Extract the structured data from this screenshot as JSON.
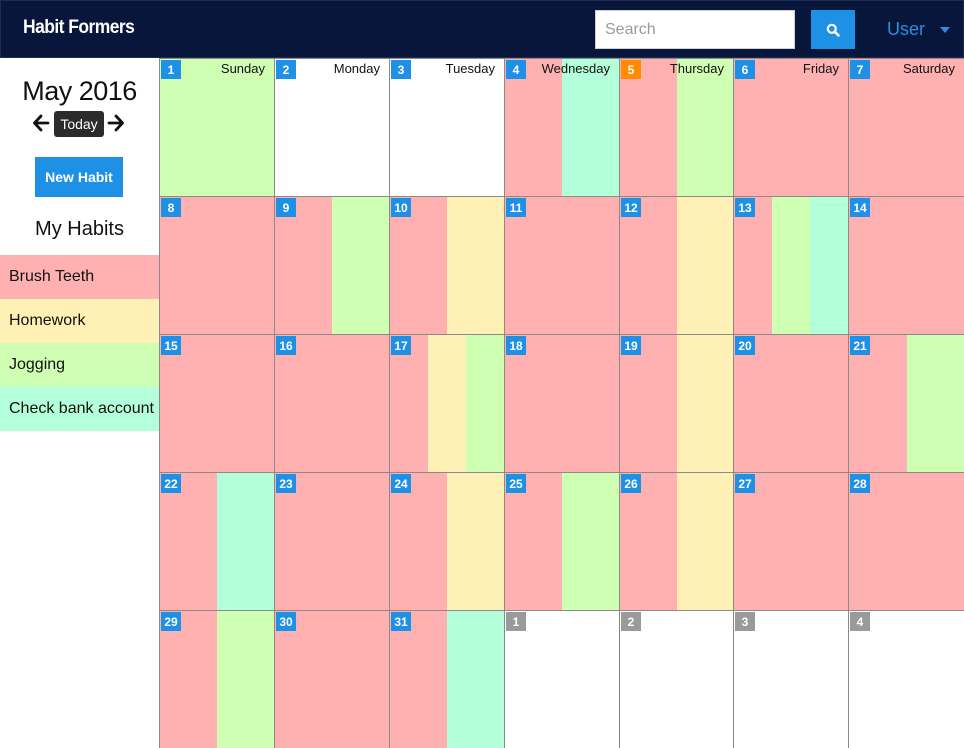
{
  "app": {
    "brand": "Habit Formers"
  },
  "search": {
    "placeholder": "Search"
  },
  "user_menu": {
    "label": "User"
  },
  "sidebar": {
    "month_title": "May 2016",
    "today_label": "Today",
    "new_habit_label": "New Habit",
    "habits_heading": "My Habits"
  },
  "habits": [
    {
      "name": "Brush Teeth",
      "color": "#ffb1b1"
    },
    {
      "name": "Homework",
      "color": "#fff0b5"
    },
    {
      "name": "Jogging",
      "color": "#cfffb3"
    },
    {
      "name": "Check bank account",
      "color": "#b3ffd9"
    }
  ],
  "colors": {
    "navbar": "#07163a",
    "accent_blue": "#1e90e6",
    "badge_current_month": "#1e90e6",
    "badge_today": "#ff8c00",
    "badge_other_month": "#9a9a9a"
  },
  "weekdays": [
    "Sunday",
    "Monday",
    "Tuesday",
    "Wednesday",
    "Thursday",
    "Friday",
    "Saturday"
  ],
  "calendar": {
    "weeks": [
      [
        {
          "day": "1",
          "status": "current",
          "habits": [
            2
          ]
        },
        {
          "day": "2",
          "status": "current",
          "habits": []
        },
        {
          "day": "3",
          "status": "current",
          "habits": []
        },
        {
          "day": "4",
          "status": "current",
          "habits": [
            0,
            3
          ]
        },
        {
          "day": "5",
          "status": "today",
          "habits": [
            0,
            2
          ]
        },
        {
          "day": "6",
          "status": "current",
          "habits": [
            0
          ]
        },
        {
          "day": "7",
          "status": "current",
          "habits": [
            0
          ]
        }
      ],
      [
        {
          "day": "8",
          "status": "current",
          "habits": [
            0
          ]
        },
        {
          "day": "9",
          "status": "current",
          "habits": [
            0,
            2
          ]
        },
        {
          "day": "10",
          "status": "current",
          "habits": [
            0,
            1
          ]
        },
        {
          "day": "11",
          "status": "current",
          "habits": [
            0
          ]
        },
        {
          "day": "12",
          "status": "current",
          "habits": [
            0,
            1
          ]
        },
        {
          "day": "13",
          "status": "current",
          "habits": [
            0,
            2,
            3
          ]
        },
        {
          "day": "14",
          "status": "current",
          "habits": [
            0
          ]
        }
      ],
      [
        {
          "day": "15",
          "status": "current",
          "habits": [
            0
          ]
        },
        {
          "day": "16",
          "status": "current",
          "habits": [
            0
          ]
        },
        {
          "day": "17",
          "status": "current",
          "habits": [
            0,
            1,
            2
          ]
        },
        {
          "day": "18",
          "status": "current",
          "habits": [
            0
          ]
        },
        {
          "day": "19",
          "status": "current",
          "habits": [
            0,
            1
          ]
        },
        {
          "day": "20",
          "status": "current",
          "habits": [
            0
          ]
        },
        {
          "day": "21",
          "status": "current",
          "habits": [
            0,
            2
          ]
        }
      ],
      [
        {
          "day": "22",
          "status": "current",
          "habits": [
            0,
            3
          ]
        },
        {
          "day": "23",
          "status": "current",
          "habits": [
            0
          ]
        },
        {
          "day": "24",
          "status": "current",
          "habits": [
            0,
            1
          ]
        },
        {
          "day": "25",
          "status": "current",
          "habits": [
            0,
            2
          ]
        },
        {
          "day": "26",
          "status": "current",
          "habits": [
            0,
            1
          ]
        },
        {
          "day": "27",
          "status": "current",
          "habits": [
            0
          ]
        },
        {
          "day": "28",
          "status": "current",
          "habits": [
            0
          ]
        }
      ],
      [
        {
          "day": "29",
          "status": "current",
          "habits": [
            0,
            2
          ]
        },
        {
          "day": "30",
          "status": "current",
          "habits": [
            0
          ]
        },
        {
          "day": "31",
          "status": "current",
          "habits": [
            0,
            3
          ]
        },
        {
          "day": "1",
          "status": "other",
          "habits": []
        },
        {
          "day": "2",
          "status": "other",
          "habits": []
        },
        {
          "day": "3",
          "status": "other",
          "habits": []
        },
        {
          "day": "4",
          "status": "other",
          "habits": []
        }
      ]
    ]
  }
}
